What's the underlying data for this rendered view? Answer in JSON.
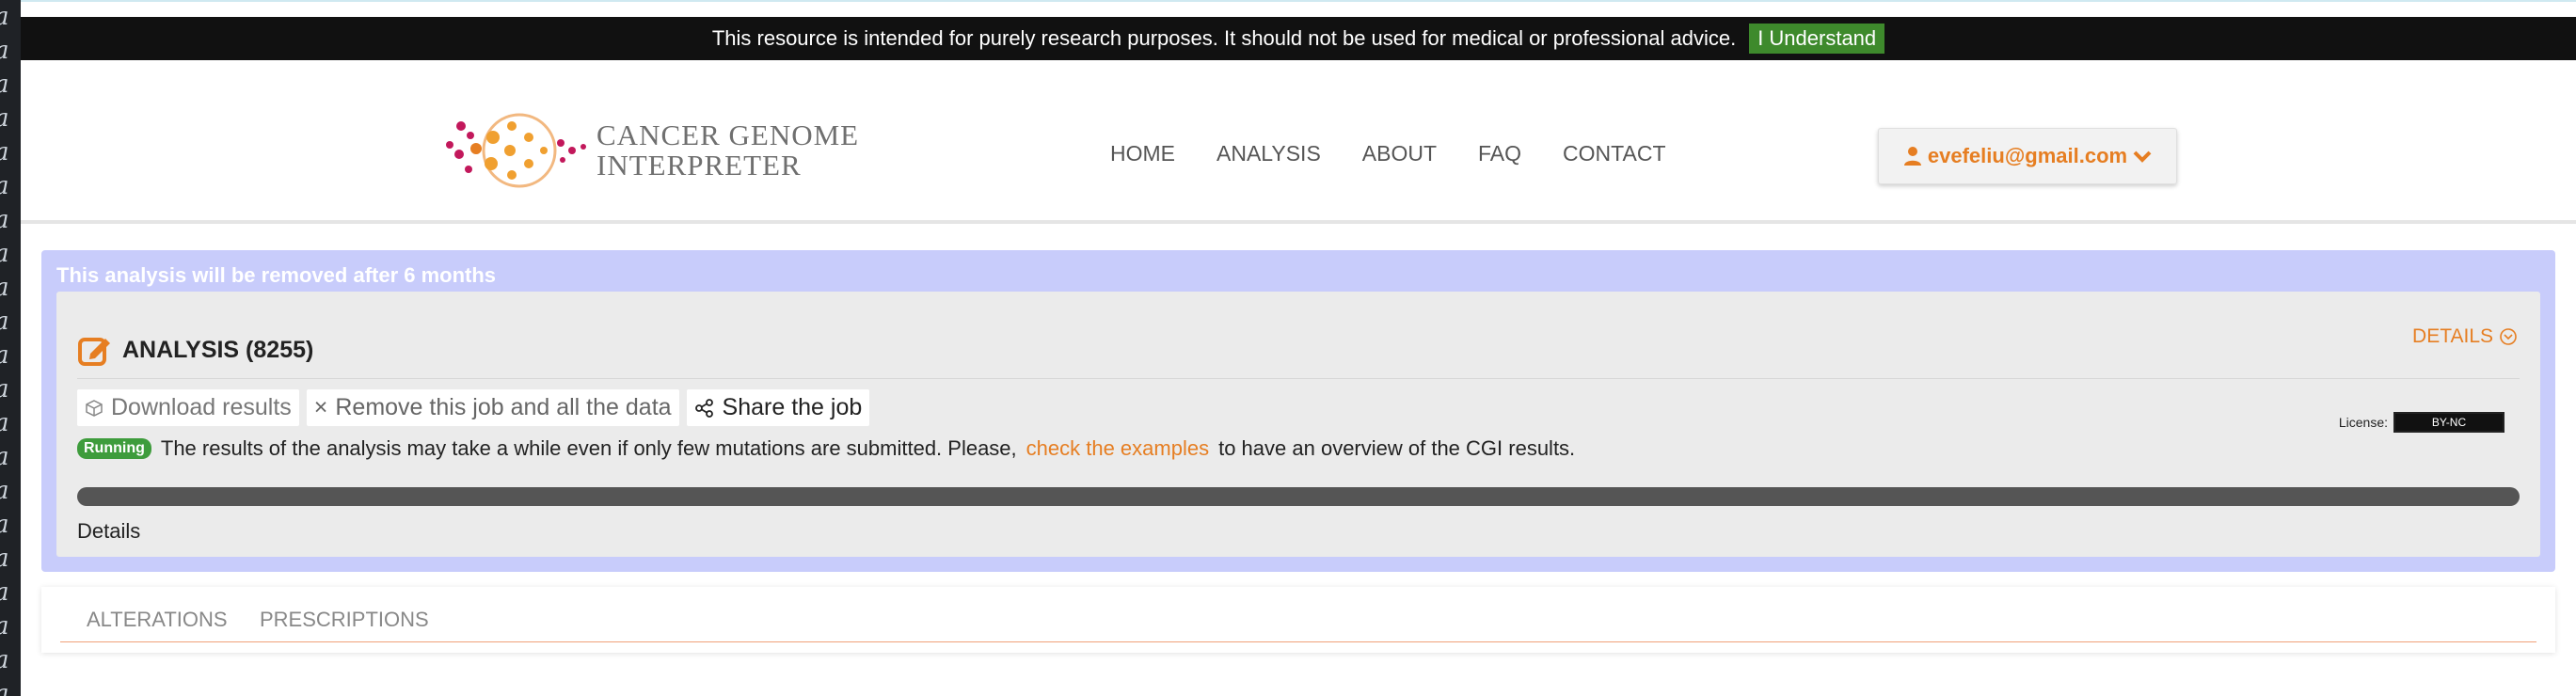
{
  "cookie_bar": {
    "text": "This resource is intended for purely research purposes. It should not be used for medical or professional advice.",
    "button": "I Understand"
  },
  "header": {
    "logo_line1": "CANCER GENOME",
    "logo_line2": "INTERPRETER",
    "nav": [
      "HOME",
      "ANALYSIS",
      "ABOUT",
      "FAQ",
      "CONTACT"
    ],
    "user": "evefeliu@gmail.com"
  },
  "analysis": {
    "notice": "This analysis will be removed after 6 months",
    "title": "ANALYSIS (8255)",
    "details_link": "DETAILS",
    "actions": {
      "download": "Download results",
      "remove": "Remove this job and all the data",
      "share": "Share the job"
    },
    "license_label": "License:",
    "license_badge": "BY-NC",
    "status_badge": "Running",
    "message_pre": "The results of the analysis may take a while even if only few mutations are submitted. Please,",
    "message_link": "check the examples",
    "message_post": "to have an overview of the CGI results.",
    "progress": 1.0,
    "details_label": "Details"
  },
  "tabs": [
    "ALTERATIONS",
    "PRESCRIPTIONS"
  ],
  "colors": {
    "accent": "#e67e22",
    "panel": "#c8ccfb",
    "running": "#3e9c3c"
  }
}
